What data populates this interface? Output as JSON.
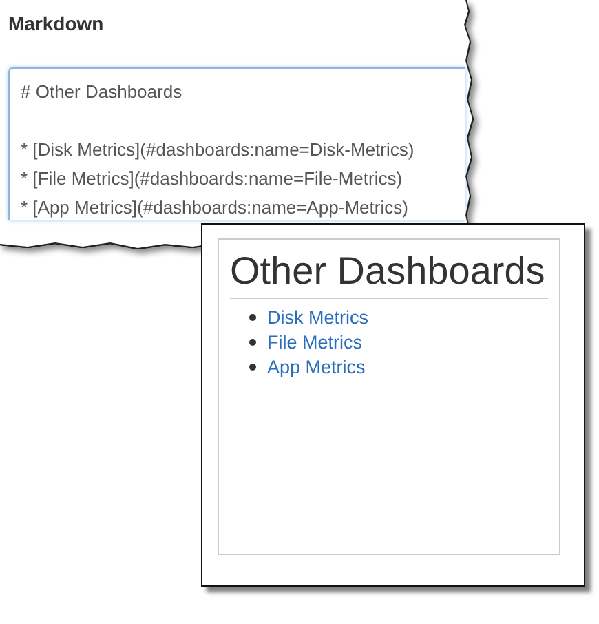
{
  "editor": {
    "title": "Markdown",
    "heading_line": "# Other Dashboards",
    "list_lines": [
      "* [Disk Metrics](#dashboards:name=Disk-Metrics)",
      "* [File Metrics](#dashboards:name=File-Metrics)",
      "* [App Metrics](#dashboards:name=App-Metrics)"
    ]
  },
  "preview": {
    "heading": "Other Dashboards",
    "links": [
      "Disk Metrics",
      "File Metrics",
      "App Metrics"
    ]
  }
}
